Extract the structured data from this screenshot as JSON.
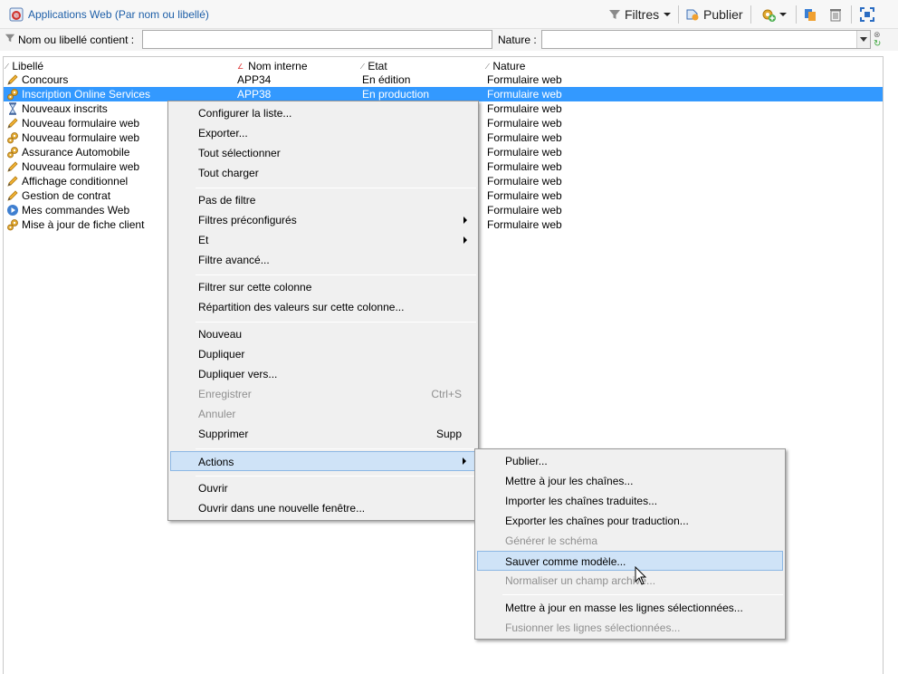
{
  "window": {
    "title": "Applications Web (Par nom ou libellé)"
  },
  "toolbar": {
    "filters_label": "Filtres",
    "publish_label": "Publier"
  },
  "filter": {
    "name_label": "Nom ou libellé contient :",
    "name_value": "",
    "nature_label": "Nature :",
    "nature_value": ""
  },
  "list": {
    "columns": [
      "Libellé",
      "Nom interne",
      "Etat",
      "Nature"
    ],
    "rows": [
      {
        "icon": "pencil-icon",
        "label": "Concours",
        "internal": "APP34",
        "state": "En édition",
        "nature": "Formulaire web"
      },
      {
        "icon": "gears-icon",
        "label": "Inscription Online Services",
        "internal": "APP38",
        "state": "En production",
        "nature": "Formulaire web"
      },
      {
        "icon": "hourglass-icon",
        "label": "Nouveaux inscrits",
        "internal": "",
        "state": "",
        "nature": "Formulaire web"
      },
      {
        "icon": "pencil-icon",
        "label": "Nouveau formulaire web",
        "internal": "",
        "state": "",
        "nature": "Formulaire web"
      },
      {
        "icon": "gears-icon",
        "label": "Nouveau formulaire web",
        "internal": "",
        "state": "",
        "nature": "Formulaire web"
      },
      {
        "icon": "gears-icon",
        "label": "Assurance Automobile",
        "internal": "",
        "state": "",
        "nature": "Formulaire web"
      },
      {
        "icon": "pencil-icon",
        "label": "Nouveau formulaire web",
        "internal": "",
        "state": "",
        "nature": "Formulaire web"
      },
      {
        "icon": "pencil-icon",
        "label": "Affichage conditionnel",
        "internal": "",
        "state": "",
        "nature": "Formulaire web"
      },
      {
        "icon": "pencil-icon",
        "label": "Gestion de contrat",
        "internal": "",
        "state": "",
        "nature": "Formulaire web"
      },
      {
        "icon": "play-icon",
        "label": "Mes commandes Web",
        "internal": "",
        "state": "",
        "nature": "Formulaire web"
      },
      {
        "icon": "gears-icon",
        "label": "Mise à jour de fiche client",
        "internal": "",
        "state": "",
        "nature": "Formulaire web"
      }
    ]
  },
  "context_menu": {
    "items": [
      {
        "label": "Configurer la liste...",
        "shortcut": ""
      },
      {
        "label": "Exporter...",
        "shortcut": ""
      },
      {
        "label": "Tout sélectionner",
        "shortcut": ""
      },
      {
        "label": "Tout charger",
        "shortcut": ""
      },
      {
        "label": "Pas de filtre",
        "shortcut": ""
      },
      {
        "label": "Filtres préconfigurés",
        "shortcut": ""
      },
      {
        "label": "Et",
        "shortcut": ""
      },
      {
        "label": "Filtre avancé...",
        "shortcut": ""
      },
      {
        "label": "Filtrer sur cette colonne",
        "shortcut": ""
      },
      {
        "label": "Répartition des valeurs sur cette colonne...",
        "shortcut": ""
      },
      {
        "label": "Nouveau",
        "shortcut": ""
      },
      {
        "label": "Dupliquer",
        "shortcut": ""
      },
      {
        "label": "Dupliquer vers...",
        "shortcut": ""
      },
      {
        "label": "Enregistrer",
        "shortcut": "Ctrl+S"
      },
      {
        "label": "Annuler",
        "shortcut": ""
      },
      {
        "label": "Supprimer",
        "shortcut": "Supp"
      },
      {
        "label": "Actions",
        "shortcut": ""
      },
      {
        "label": "Ouvrir",
        "shortcut": ""
      },
      {
        "label": "Ouvrir dans une nouvelle fenêtre...",
        "shortcut": ""
      }
    ]
  },
  "actions_submenu": {
    "items": [
      {
        "label": "Publier..."
      },
      {
        "label": "Mettre à jour les chaînes..."
      },
      {
        "label": "Importer les chaînes traduites..."
      },
      {
        "label": "Exporter les chaînes pour traduction..."
      },
      {
        "label": "Générer le schéma"
      },
      {
        "label": "Sauver comme modèle..."
      },
      {
        "label": "Normaliser un champ archivé..."
      },
      {
        "label": "Mettre à jour en masse les lignes sélectionnées..."
      },
      {
        "label": "Fusionner les lignes sélectionnées..."
      }
    ]
  }
}
